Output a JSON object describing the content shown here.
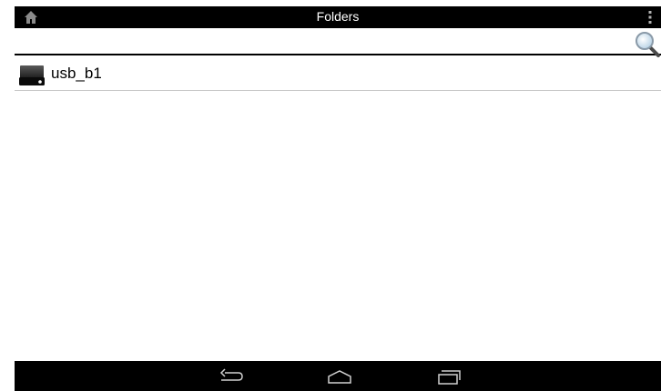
{
  "header": {
    "title": "Folders",
    "home_icon": "home-icon",
    "menu_icon": "overflow-menu-icon"
  },
  "search": {
    "value": "",
    "placeholder": "",
    "icon": "magnifier-icon"
  },
  "folders": [
    {
      "label": "usb_b1",
      "icon": "usb-drive-icon"
    }
  ],
  "navigation": {
    "buttons": [
      "back-icon",
      "home-outline-icon",
      "recent-apps-icon"
    ]
  },
  "colors": {
    "bar": "#000000",
    "background": "#ffffff",
    "divider": "#c8c8c8"
  }
}
